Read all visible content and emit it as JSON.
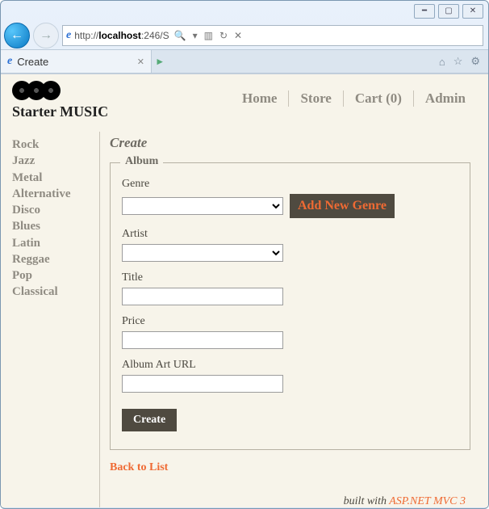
{
  "window": {
    "url_prefix": "http://",
    "url_host": "localhost",
    "url_rest": ":246/S",
    "tab_title": "Create"
  },
  "brand": {
    "title": "Starter MUSIC"
  },
  "topnav": {
    "home": "Home",
    "store": "Store",
    "cart": "Cart (0)",
    "admin": "Admin"
  },
  "sidebar": {
    "items": [
      "Rock",
      "Jazz",
      "Metal",
      "Alternative",
      "Disco",
      "Blues",
      "Latin",
      "Reggae",
      "Pop",
      "Classical"
    ]
  },
  "main": {
    "heading": "Create",
    "legend": "Album",
    "labels": {
      "genre": "Genre",
      "artist": "Artist",
      "title": "Title",
      "price": "Price",
      "arturl": "Album Art URL"
    },
    "values": {
      "genre": "",
      "artist": "",
      "title": "",
      "price": "",
      "arturl": ""
    },
    "buttons": {
      "add_genre": "Add New Genre",
      "create": "Create"
    },
    "back_link": "Back to List"
  },
  "footer": {
    "prefix": "built with ",
    "link": "ASP.NET MVC 3"
  }
}
